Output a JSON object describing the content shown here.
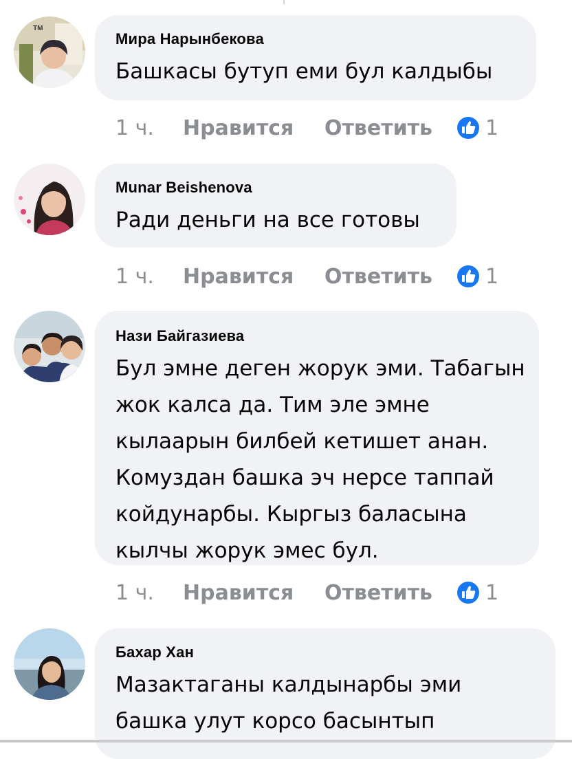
{
  "reaction_color": "#1877f2",
  "comments": [
    {
      "author": "Мира Нарынбекова",
      "text": "Башкасы бутуп еми бул калдыбы",
      "time": "1 ч.",
      "like_label": "Нравится",
      "reply_label": "Ответить",
      "reaction_count": "1",
      "avatar_badge": "TM"
    },
    {
      "author": "Munar Beishenova",
      "text": "Ради деньги на все готовы",
      "time": "1 ч.",
      "like_label": "Нравится",
      "reply_label": "Ответить",
      "reaction_count": "1"
    },
    {
      "author": "Нази Байгазиева",
      "text": "Бул эмне деген жорук эми. Табагын жок калса да. Тим эле эмне кылаарын билбей кетишет анан. Комуздан башка эч нерсе таппай койдунарбы.  Кыргыз баласына кылчы жорук эмес бул.",
      "time": "1 ч.",
      "like_label": "Нравится",
      "reply_label": "Ответить",
      "reaction_count": "1"
    },
    {
      "author": "Бахар Хан",
      "text": "Мазактаганы калдынарбы эми башка улут корсо басынтып"
    }
  ]
}
